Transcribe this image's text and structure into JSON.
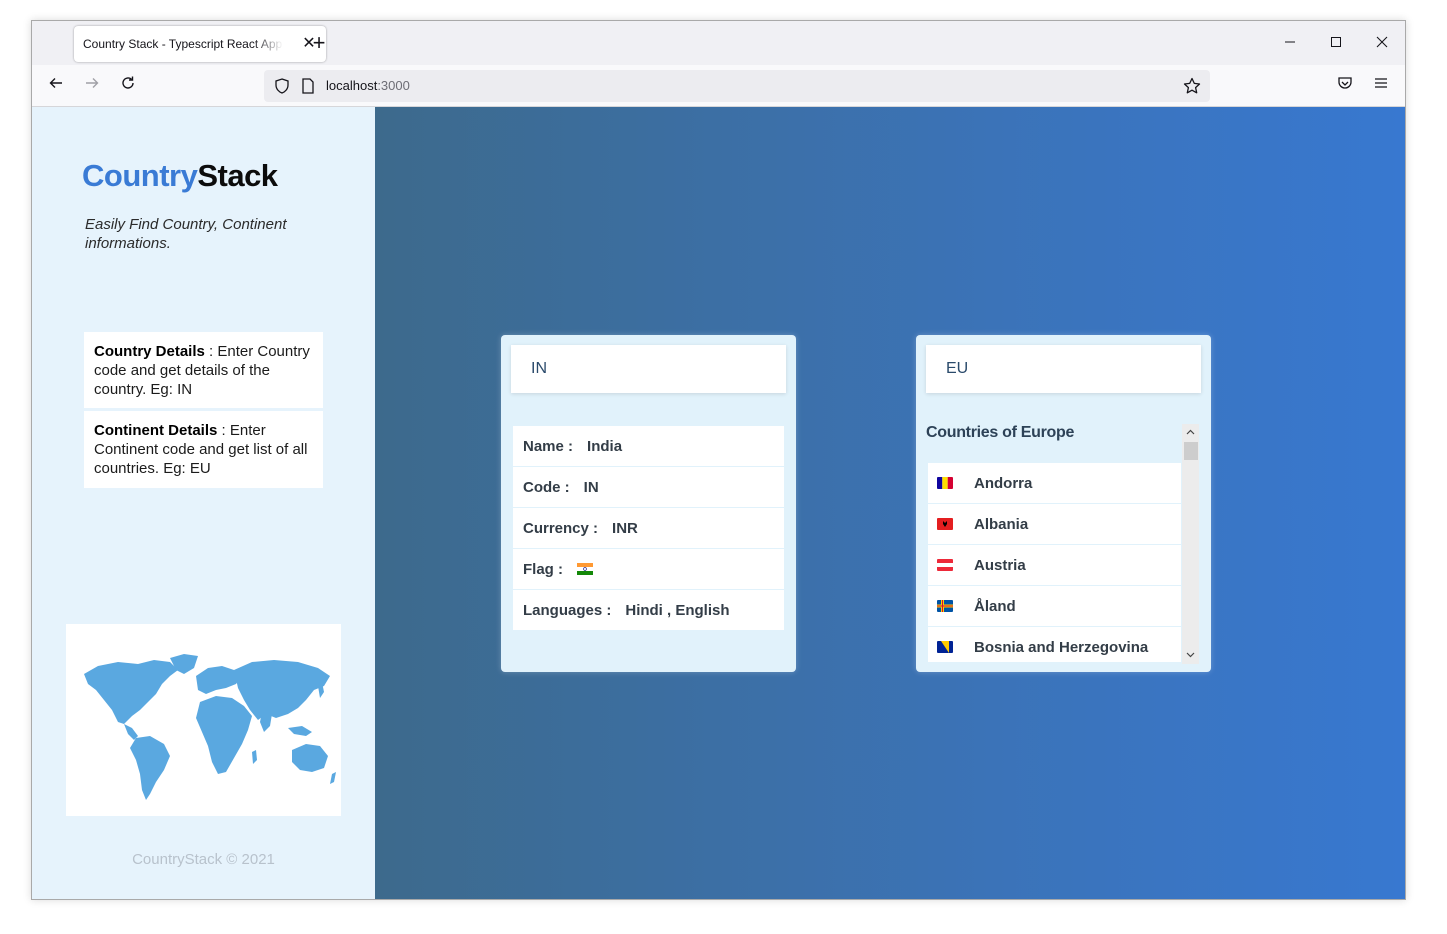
{
  "browser": {
    "tab_title": "Country Stack - Typescript React App",
    "tab_close": "✕",
    "new_tab": "+",
    "url_host": "localhost",
    "url_port": ":3000",
    "controls": {
      "minimize": "─",
      "maximize": "☐",
      "close": "✕"
    },
    "nav": {
      "back": "←",
      "forward": "→",
      "reload": "↻",
      "menu": "≡"
    }
  },
  "sidebar": {
    "logo_part1": "Country",
    "logo_part2": "Stack",
    "tagline": "Easily Find Country, Continent informations.",
    "info": [
      {
        "title": "Country Details",
        "text": " : Enter Country code and get details of the country. Eg: IN"
      },
      {
        "title": "Continent Details",
        "text": " : Enter Continent code and get list of all countries. Eg: EU"
      }
    ],
    "footer": "CountryStack © 2021"
  },
  "country_card": {
    "input_value": "IN",
    "rows": [
      {
        "label": "Name :",
        "value": "India"
      },
      {
        "label": "Code :",
        "value": "IN"
      },
      {
        "label": "Currency :",
        "value": "INR"
      },
      {
        "label": "Flag :",
        "value": ""
      },
      {
        "label": "Languages :",
        "value": "Hindi , English"
      }
    ]
  },
  "continent_card": {
    "input_value": "EU",
    "title": "Countries of Europe",
    "countries": [
      {
        "name": "Andorra",
        "flag": "andorra-flag-icon"
      },
      {
        "name": "Albania",
        "flag": "albania-flag-icon"
      },
      {
        "name": "Austria",
        "flag": "austria-flag-icon"
      },
      {
        "name": "Åland",
        "flag": "aland-flag-icon"
      },
      {
        "name": "Bosnia and Herzegovina",
        "flag": "bosnia-flag-icon"
      }
    ],
    "scroll_up": "⌃",
    "scroll_down": "⌄"
  },
  "colors": {
    "brand_blue": "#3a7bd5",
    "sidebar_bg": "#e6f3fc",
    "main_gradient_start": "#3d6a8c",
    "main_gradient_end": "#3878d0",
    "card_bg": "#e1f2fb"
  }
}
